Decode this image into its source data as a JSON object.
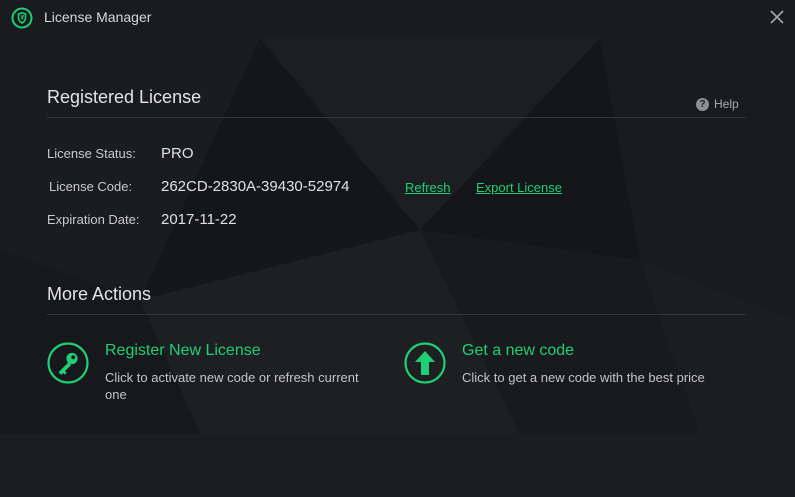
{
  "window": {
    "title": "License Manager",
    "accent_color": "#1fcf73"
  },
  "registered": {
    "title": "Registered License",
    "help_label": "Help",
    "fields": {
      "status_label": "License Status:",
      "status_value": "PRO",
      "code_label": "License Code:",
      "code_value": "262CD-2830A-39430-52974",
      "expiration_label": "Expiration Date:",
      "expiration_value": "2017-11-22"
    },
    "refresh_link": "Refresh",
    "export_link": "Export License"
  },
  "more_actions": {
    "title": "More Actions",
    "register": {
      "title": "Register New License",
      "description_line1": "Click to activate new code or refresh current",
      "description_line2": "one",
      "icon": "key-icon"
    },
    "get_code": {
      "title": "Get a new code",
      "description": "Click to get a new code with the best price",
      "icon": "arrow-up-icon"
    }
  }
}
